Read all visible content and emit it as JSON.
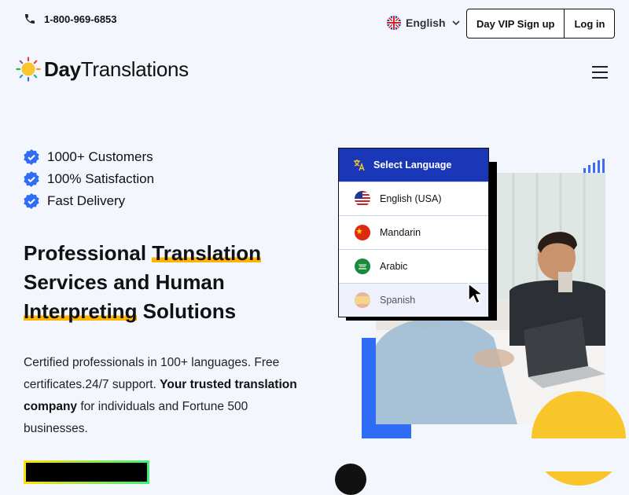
{
  "topbar": {
    "phone": "1-800-969-6853",
    "language": "English",
    "vip_label": "Day VIP Sign up",
    "login_label": "Log in"
  },
  "logo": {
    "bold": "Day",
    "rest": "Translations"
  },
  "features": [
    "1000+ Customers",
    "100% Satisfaction",
    "Fast Delivery"
  ],
  "headline": {
    "w1": "Professional ",
    "w2": "Translation",
    "w3": "Services and Human",
    "w4": "Interpreting",
    "w5": " Solutions"
  },
  "description": {
    "p1": "Certified professionals in 100+ languages. Free certificates.24/7 support. ",
    "bold": "Your trusted translation company",
    "p2": " for individuals and Fortune 500 businesses."
  },
  "dropdown": {
    "title": "Select Language",
    "items": [
      "English (USA)",
      "Mandarin",
      "Arabic",
      "Spanish"
    ]
  },
  "colors": {
    "accent_blue": "#1a37b8",
    "highlight": "#ffb400",
    "brand_blue": "#2f6df6",
    "yellow": "#f8c52b"
  }
}
